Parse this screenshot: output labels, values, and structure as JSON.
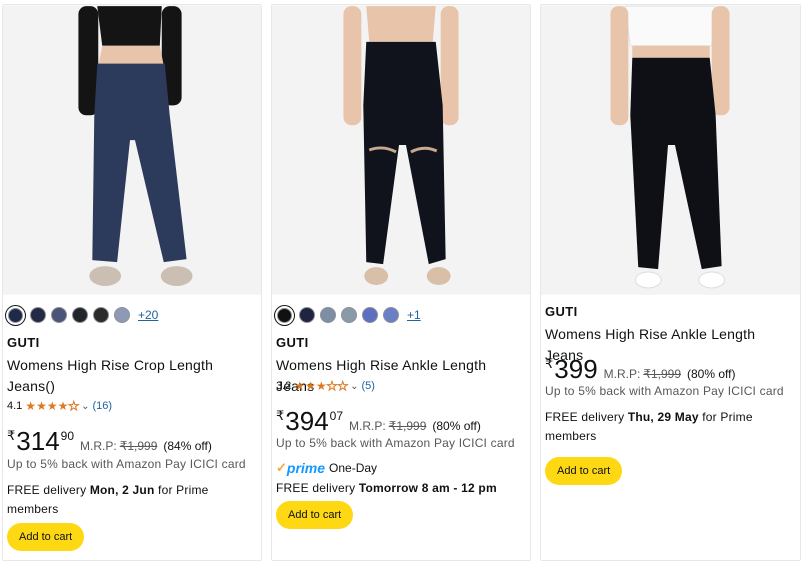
{
  "products": [
    {
      "swatches": [
        "#1e2a4a",
        "#232a45",
        "#4a5578",
        "#22262b",
        "#2b2b2b",
        "#8e9ab5"
      ],
      "more_colors": "+20",
      "brand": "GUTI",
      "title_line1": "Womens High Rise Crop Length",
      "title_line2": "Jeans()",
      "rating": "4.1",
      "stars": 4,
      "review_count": "(16)",
      "currency": "₹",
      "price_whole": "314",
      "price_fraction": "90",
      "mrp_label": "M.R.P:",
      "mrp": "₹1,999",
      "discount": "(84% off)",
      "cashback": "Up to 5% back with Amazon Pay ICICI card",
      "delivery_prefix": "FREE delivery ",
      "delivery_date": "Mon, 2 Jun",
      "delivery_suffix": " for Prime",
      "delivery_line2": "members",
      "button": "Add to cart",
      "jeans_color": "#2c3a5c"
    },
    {
      "swatches": [
        "#111111",
        "#1f2540",
        "#7d8fa3",
        "#8a9aa8",
        "#5c6fc0",
        "#6b7fc7"
      ],
      "more_colors": "+1",
      "brand": "GUTI",
      "title_line1": "Womens High Rise Ankle Length Jeans",
      "rating": "3.2",
      "stars": 3,
      "review_count": "(5)",
      "currency": "₹",
      "price_whole": "394",
      "price_fraction": "07",
      "mrp_label": "M.R.P:",
      "mrp": "₹1,999",
      "discount": "(80% off)",
      "cashback": "Up to 5% back with Amazon Pay ICICI card",
      "prime_word": "prime",
      "prime_label": "One-Day",
      "delivery_prefix": "FREE delivery ",
      "delivery_date": "Tomorrow 8 am - 12 pm",
      "button": "Add to cart",
      "jeans_color": "#10131c"
    },
    {
      "brand": "GUTI",
      "title_line1": "Womens High Rise Ankle Length Jeans",
      "currency": "₹",
      "price_whole": "399",
      "mrp_label": "M.R.P:",
      "mrp": "₹1,999",
      "discount": "(80% off)",
      "cashback": "Up to 5% back with Amazon Pay ICICI card",
      "delivery_prefix": "FREE delivery ",
      "delivery_date": "Thu, 29 May",
      "delivery_suffix": " for Prime",
      "delivery_line2": "members",
      "button": "Add to cart",
      "jeans_color": "#0e1016"
    }
  ]
}
